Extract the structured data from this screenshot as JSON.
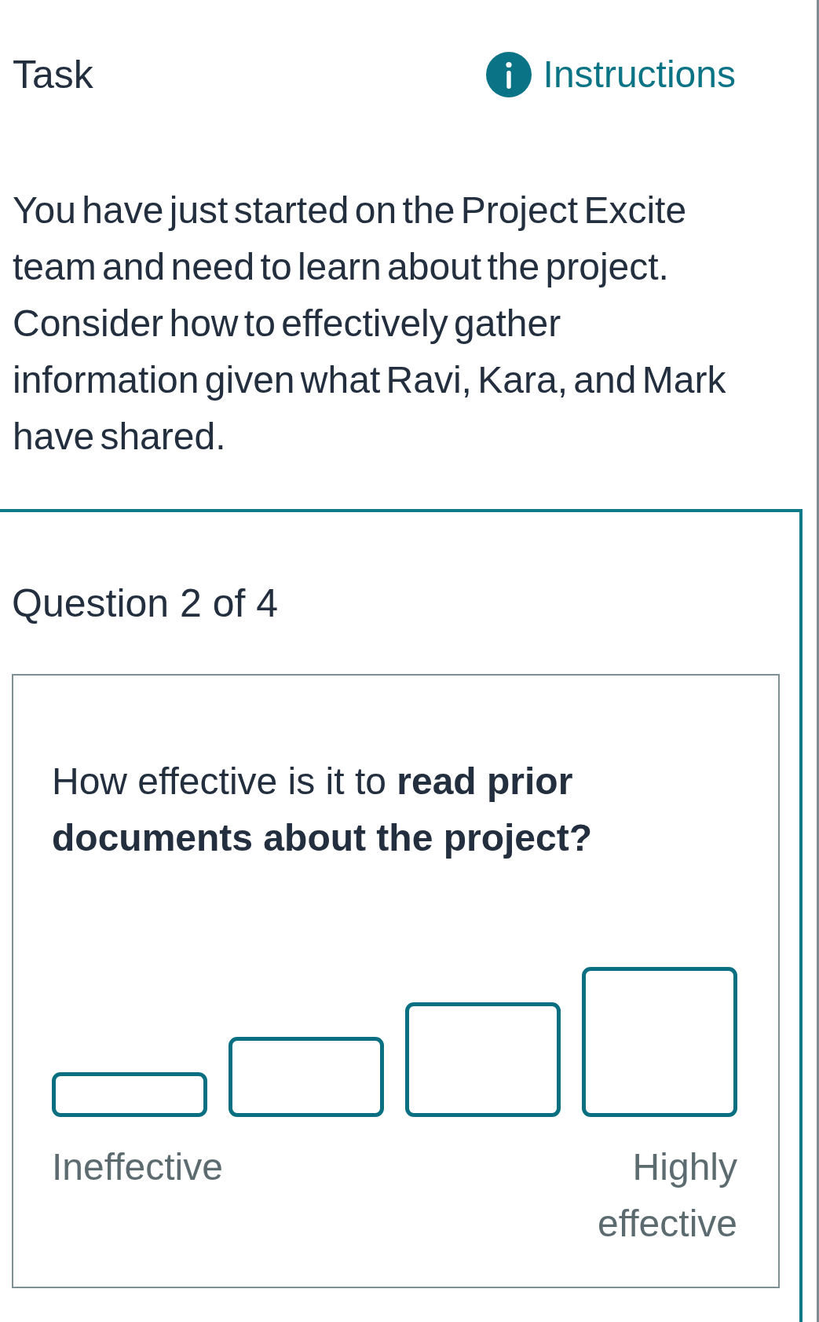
{
  "header": {
    "title": "Task",
    "instructions_link": "Instructions"
  },
  "description": "You have just started on the Project Excite team and need to learn about the project. Consider how to effectively gather information given what Ravi, Kara, and Mark have shared.",
  "question": {
    "counter": "Question 2 of 4",
    "prompt": "How effective is it to **read prior documents about the project?**",
    "scale": {
      "options": [
        {
          "selected": false
        },
        {
          "selected": false
        },
        {
          "selected": false
        },
        {
          "selected": false
        }
      ],
      "min_label": "Ineffective",
      "max_label": "Highly effective"
    }
  }
}
